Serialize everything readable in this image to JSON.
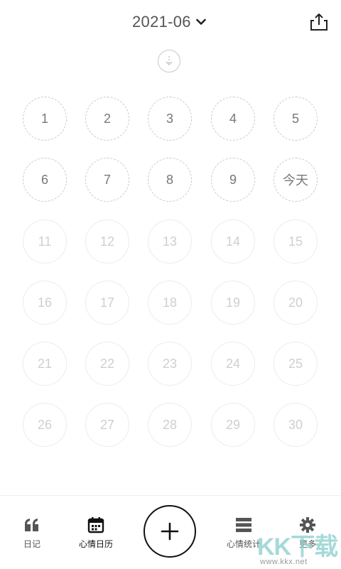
{
  "header": {
    "month": "2021-06",
    "chevron_icon": "chevron-down-icon",
    "share_icon": "share-icon"
  },
  "pull_hint_icon": "pull-down-icon",
  "calendar": {
    "today_label": "今天",
    "days": [
      {
        "label": "1",
        "state": "past"
      },
      {
        "label": "2",
        "state": "past"
      },
      {
        "label": "3",
        "state": "past"
      },
      {
        "label": "4",
        "state": "past"
      },
      {
        "label": "5",
        "state": "past"
      },
      {
        "label": "6",
        "state": "past"
      },
      {
        "label": "7",
        "state": "past"
      },
      {
        "label": "8",
        "state": "past"
      },
      {
        "label": "9",
        "state": "past"
      },
      {
        "label": "今天",
        "state": "today"
      },
      {
        "label": "11",
        "state": "future"
      },
      {
        "label": "12",
        "state": "future"
      },
      {
        "label": "13",
        "state": "future"
      },
      {
        "label": "14",
        "state": "future"
      },
      {
        "label": "15",
        "state": "future"
      },
      {
        "label": "16",
        "state": "future"
      },
      {
        "label": "17",
        "state": "future"
      },
      {
        "label": "18",
        "state": "future"
      },
      {
        "label": "19",
        "state": "future"
      },
      {
        "label": "20",
        "state": "future"
      },
      {
        "label": "21",
        "state": "future"
      },
      {
        "label": "22",
        "state": "future"
      },
      {
        "label": "23",
        "state": "future"
      },
      {
        "label": "24",
        "state": "future"
      },
      {
        "label": "25",
        "state": "future"
      },
      {
        "label": "26",
        "state": "future"
      },
      {
        "label": "27",
        "state": "future"
      },
      {
        "label": "28",
        "state": "future"
      },
      {
        "label": "29",
        "state": "future"
      },
      {
        "label": "30",
        "state": "future"
      }
    ]
  },
  "tabbar": {
    "items": [
      {
        "label": "日记",
        "icon": "quote-icon"
      },
      {
        "label": "心情日历",
        "icon": "calendar-icon",
        "active": true
      },
      {
        "label": "心情统计",
        "icon": "list-icon"
      },
      {
        "label": "更多",
        "icon": "gear-icon"
      }
    ],
    "add_icon": "plus-icon"
  },
  "watermark": {
    "text": "KK下载",
    "url": "www.kkx.net"
  }
}
